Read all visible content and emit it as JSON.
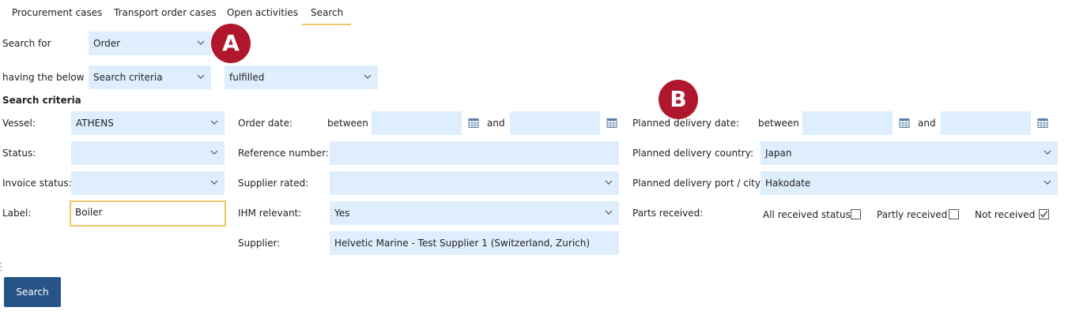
{
  "tabs": [
    {
      "label": "Procurement cases"
    },
    {
      "label": "Transport order cases"
    },
    {
      "label": "Open activities"
    },
    {
      "label": "Search"
    }
  ],
  "search_for": {
    "label": "Search for",
    "value": "Order"
  },
  "having": {
    "label": "having the below",
    "criteria_value": "Search criteria",
    "status_value": "fulfilled"
  },
  "markers": {
    "a": "A",
    "b": "B"
  },
  "section_title": "Search criteria",
  "col1": {
    "vessel": {
      "label": "Vessel:",
      "value": "ATHENS"
    },
    "status": {
      "label": "Status:",
      "value": ""
    },
    "invoice_status": {
      "label": "Invoice status:",
      "value": ""
    },
    "label": {
      "label": "Label:",
      "value": "Boiler"
    }
  },
  "col2": {
    "order_date": {
      "label": "Order date:",
      "between": "between",
      "and": "and",
      "from": "",
      "to": ""
    },
    "reference_number": {
      "label": "Reference number:",
      "value": ""
    },
    "supplier_rated": {
      "label": "Supplier rated:",
      "value": ""
    },
    "ihm_relevant": {
      "label": "IHM relevant:",
      "value": "Yes"
    },
    "supplier": {
      "label": "Supplier:",
      "value": "Helvetic Marine - Test Supplier 1 (Switzerland, Zurich)"
    }
  },
  "col3": {
    "planned_delivery_date": {
      "label": "Planned delivery date:",
      "between": "between",
      "and": "and",
      "from": "",
      "to": ""
    },
    "planned_delivery_country": {
      "label": "Planned delivery country:",
      "value": "Japan"
    },
    "planned_delivery_port": {
      "label": "Planned delivery port / city:",
      "value": "Hakodate"
    },
    "parts_received": {
      "label": "Parts received:",
      "options": [
        {
          "label": "All received status",
          "checked": false
        },
        {
          "label": "Partly received",
          "checked": false
        },
        {
          "label": "Not received",
          "checked": true
        }
      ]
    }
  },
  "search_button": "Search",
  "colors": {
    "field_bg": "#dfeefd",
    "accent": "#f0c66a",
    "button": "#275486",
    "marker": "#b0172c"
  },
  "icons": {
    "dropdown": "chevron-down-icon",
    "date": "calendar-icon",
    "checkbox": "checkbox-icon"
  }
}
